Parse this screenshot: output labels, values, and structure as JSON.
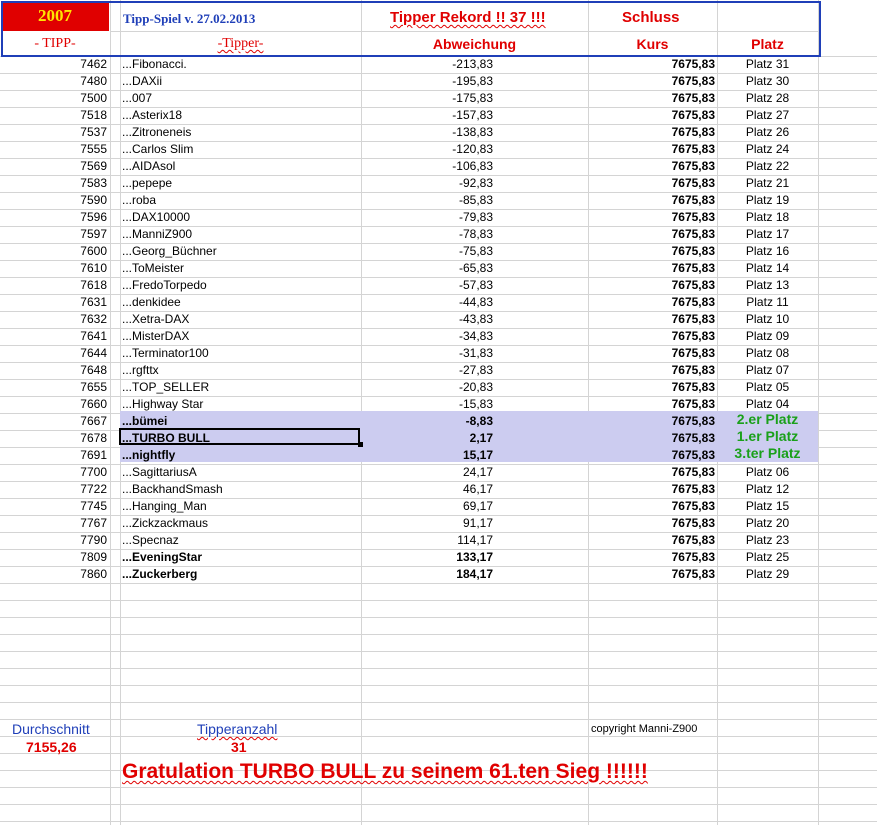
{
  "header": {
    "year": "2007",
    "title": "Tipp-Spiel v. 27.02.2013",
    "rekord": "Tipper Rekord !!  37  !!!",
    "schluss": "Schluss",
    "col_tipp": "- TIPP-",
    "col_tipper": "-Tipper-",
    "col_abweichung": "Abweichung",
    "col_kurs": "Kurs",
    "col_platz": "Platz"
  },
  "rows": [
    {
      "tipp": "7462",
      "name": "...Fibonacci.",
      "abw": "-213,83",
      "kurs": "7675,83",
      "platz": "Platz 31"
    },
    {
      "tipp": "7480",
      "name": "...DAXii",
      "abw": "-195,83",
      "kurs": "7675,83",
      "platz": "Platz 30"
    },
    {
      "tipp": "7500",
      "name": "...007",
      "abw": "-175,83",
      "kurs": "7675,83",
      "platz": "Platz 28"
    },
    {
      "tipp": "7518",
      "name": "...Asterix18",
      "abw": "-157,83",
      "kurs": "7675,83",
      "platz": "Platz 27"
    },
    {
      "tipp": "7537",
      "name": "...Zitroneneis",
      "abw": "-138,83",
      "kurs": "7675,83",
      "platz": "Platz 26"
    },
    {
      "tipp": "7555",
      "name": "...Carlos Slim",
      "abw": "-120,83",
      "kurs": "7675,83",
      "platz": "Platz 24"
    },
    {
      "tipp": "7569",
      "name": "...AIDAsol",
      "abw": "-106,83",
      "kurs": "7675,83",
      "platz": "Platz 22"
    },
    {
      "tipp": "7583",
      "name": "...pepepe",
      "abw": "-92,83",
      "kurs": "7675,83",
      "platz": "Platz 21"
    },
    {
      "tipp": "7590",
      "name": "...roba",
      "abw": "-85,83",
      "kurs": "7675,83",
      "platz": "Platz 19"
    },
    {
      "tipp": "7596",
      "name": "...DAX10000",
      "abw": "-79,83",
      "kurs": "7675,83",
      "platz": "Platz 18"
    },
    {
      "tipp": "7597",
      "name": "...ManniZ900",
      "abw": "-78,83",
      "kurs": "7675,83",
      "platz": "Platz 17"
    },
    {
      "tipp": "7600",
      "name": "...Georg_Büchner",
      "abw": "-75,83",
      "kurs": "7675,83",
      "platz": "Platz 16"
    },
    {
      "tipp": "7610",
      "name": "...ToMeister",
      "abw": "-65,83",
      "kurs": "7675,83",
      "platz": "Platz 14"
    },
    {
      "tipp": "7618",
      "name": "...FredoTorpedo",
      "abw": "-57,83",
      "kurs": "7675,83",
      "platz": "Platz 13"
    },
    {
      "tipp": "7631",
      "name": "...denkidee",
      "abw": "-44,83",
      "kurs": "7675,83",
      "platz": "Platz 11"
    },
    {
      "tipp": "7632",
      "name": "...Xetra-DAX",
      "abw": "-43,83",
      "kurs": "7675,83",
      "platz": "Platz 10"
    },
    {
      "tipp": "7641",
      "name": "...MisterDAX",
      "abw": "-34,83",
      "kurs": "7675,83",
      "platz": "Platz 09"
    },
    {
      "tipp": "7644",
      "name": "...Terminator100",
      "abw": "-31,83",
      "kurs": "7675,83",
      "platz": "Platz 08"
    },
    {
      "tipp": "7648",
      "name": "...rgfttx",
      "abw": "-27,83",
      "kurs": "7675,83",
      "platz": "Platz 07"
    },
    {
      "tipp": "7655",
      "name": "...TOP_SELLER",
      "abw": "-20,83",
      "kurs": "7675,83",
      "platz": "Platz 05"
    },
    {
      "tipp": "7660",
      "name": "...Highway Star",
      "abw": "-15,83",
      "kurs": "7675,83",
      "platz": "Platz 04"
    },
    {
      "tipp": "7667",
      "name": "...bümei",
      "abw": "-8,83",
      "kurs": "7675,83",
      "platz": "2.er Platz",
      "win": true
    },
    {
      "tipp": "7678",
      "name": "...TURBO BULL",
      "abw": "2,17",
      "kurs": "7675,83",
      "platz": "1.er Platz",
      "win": true
    },
    {
      "tipp": "7691",
      "name": "...nightfly",
      "abw": "15,17",
      "kurs": "7675,83",
      "platz": "3.ter Platz",
      "win": true
    },
    {
      "tipp": "7700",
      "name": "...SagittariusA",
      "abw": "24,17",
      "kurs": "7675,83",
      "platz": "Platz 06"
    },
    {
      "tipp": "7722",
      "name": "...BackhandSmash",
      "abw": "46,17",
      "kurs": "7675,83",
      "platz": "Platz 12"
    },
    {
      "tipp": "7745",
      "name": "...Hanging_Man",
      "abw": "69,17",
      "kurs": "7675,83",
      "platz": "Platz 15"
    },
    {
      "tipp": "7767",
      "name": "...Zickzackmaus",
      "abw": "91,17",
      "kurs": "7675,83",
      "platz": "Platz 20"
    },
    {
      "tipp": "7790",
      "name": "...Specnaz",
      "abw": "114,17",
      "kurs": "7675,83",
      "platz": "Platz 23"
    },
    {
      "tipp": "7809",
      "name": "...EveningStar",
      "abw": "133,17",
      "kurs": "7675,83",
      "platz": "Platz 25",
      "boldname": true
    },
    {
      "tipp": "7860",
      "name": "...Zuckerberg",
      "abw": "184,17",
      "kurs": "7675,83",
      "platz": "Platz 29",
      "boldname": true
    }
  ],
  "footer": {
    "durchschnitt_label": "Durchschnitt",
    "durchschnitt_value": "7155,26",
    "tipperanzahl_label": "Tipperanzahl",
    "tipperanzahl_value": "31",
    "copyright": "copyright Manni-Z900",
    "gratulation": "Gratulation TURBO BULL  zu seinem 61.ten Sieg !!!!!!"
  },
  "colors": {
    "red": "#e00000",
    "blue": "#1f3fb8",
    "green": "#1aa01a",
    "highlight": "#ccccf0"
  }
}
